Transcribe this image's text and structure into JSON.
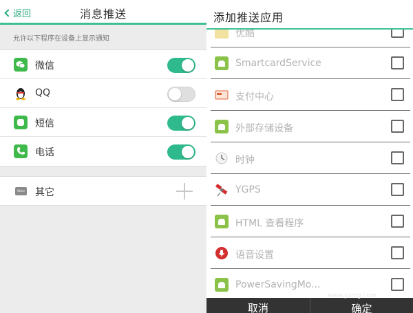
{
  "left": {
    "back_label": "返回",
    "title": "消息推送",
    "hint": "允许以下程序在设备上显示通知",
    "apps": [
      {
        "label": "微信",
        "icon": "wechat-icon",
        "enabled": true,
        "color": "#3fb94a"
      },
      {
        "label": "QQ",
        "icon": "qq-penguin-icon",
        "enabled": false,
        "color": "#222222"
      },
      {
        "label": "短信",
        "icon": "sms-icon",
        "enabled": true,
        "color": "#3fb94a"
      },
      {
        "label": "电话",
        "icon": "phone-icon",
        "enabled": true,
        "color": "#3fb94a"
      }
    ],
    "other": {
      "label": "其它",
      "icon_text": "Other"
    }
  },
  "right": {
    "title": "添加推送应用",
    "items": [
      {
        "label": "优酷",
        "icon": "youku-icon",
        "checked": false
      },
      {
        "label": "SmartcardService",
        "icon": "android-icon",
        "checked": false
      },
      {
        "label": "支付中心",
        "icon": "payment-icon",
        "checked": false
      },
      {
        "label": "外部存储设备",
        "icon": "android-icon",
        "checked": false
      },
      {
        "label": "时钟",
        "icon": "clock-icon",
        "checked": false
      },
      {
        "label": "YGPS",
        "icon": "satellite-icon",
        "checked": false
      },
      {
        "label": "HTML 查看程序",
        "icon": "android-icon",
        "checked": false
      },
      {
        "label": "语音设置",
        "icon": "microphone-icon",
        "checked": false
      },
      {
        "label": "PowerSavingMo...",
        "icon": "android-icon",
        "checked": false
      }
    ],
    "cancel_label": "取消",
    "ok_label": "确定"
  },
  "watermark": "www.yzmg.com",
  "colors": {
    "accent": "#3cbf93",
    "toggle_on": "#2fba8d",
    "bar": "#333333"
  }
}
